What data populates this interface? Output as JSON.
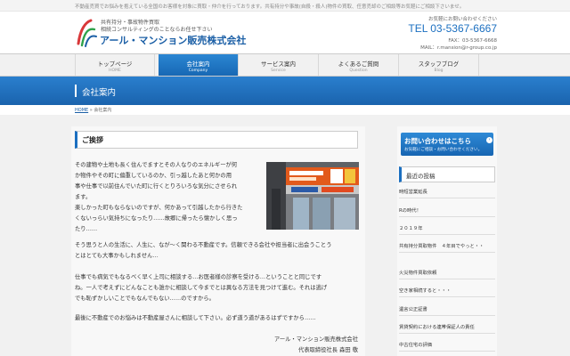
{
  "header": {
    "topbar_text": "不動産売買でお悩みを抱えている全国のお客様を対象に買取・仲介を行っております。共有持分や事故(自殺・殺人)物件の買取、任意売却のご相談等お気軽にご相談下さいませ。",
    "tagline_1": "共有持分・事故物件買取",
    "tagline_2": "相続コンサルティングのことならお任せ下さい",
    "company_name": "アール・マンション販売株式会社",
    "contact_prompt": "お気軽にお問い合わせください",
    "tel": "TEL 03-5367-6667",
    "fax": "FAX：03-5367-6668",
    "mail": "MAIL：r.mansion@r-group.co.jp"
  },
  "nav": [
    {
      "jp": "トップページ",
      "en": "HOME"
    },
    {
      "jp": "会社案内",
      "en": "Company"
    },
    {
      "jp": "サービス案内",
      "en": "Service"
    },
    {
      "jp": "よくあるご質問",
      "en": "Question"
    },
    {
      "jp": "スタッフブログ",
      "en": "Blog"
    }
  ],
  "banner_title": "会社案内",
  "breadcrumb": {
    "home": "HOME",
    "separator": " » ",
    "current": "会社案内"
  },
  "main": {
    "section_title": "ご挨拶",
    "paragraphs": [
      [
        "その建物や土地も長く住んでますとその人なりのエネルギーが何",
        "か物件やその町に偏重しているのか、引っ越したあと何かの用",
        "事や仕事で以前住んでいた町に行くとりろいろな気分にさせられ",
        "ます。"
      ],
      [
        "楽しかった町もならないのですが、何かあって引越したから行きた",
        "くないっらい気持ちになったり……故郷に帰ったら懐かしく思っ",
        "たり……"
      ],
      [
        "そう思うと人の生活に、人生に、なが〜く関わる不動産です。信頼できる会社や担当者に出会うことう",
        "とはとても大事かもしれません…"
      ],
      [
        "仕事でも病気でもなるべく早く上司に相談する…お医者様の診察を受ける…ということと同じです",
        "ね。一人で考えずにどんなことも誰かに相談して今までとは異なる方法を見つけて進む。それは逃げ",
        "でも恥ずかしいことでもなんでもない……のですから。"
      ],
      [
        "最後に不動産でのお悩みは不動産屋さんに相談して下さい。必ず道う道があるはずですから……"
      ]
    ],
    "signature_company": "アール・マンション販売株式会社",
    "signature_rep": "代表取締役社長 森田 敬"
  },
  "sidebar": {
    "contact_button_main": "お問い合わせはこちら",
    "contact_button_sub": "お気軽にご相談・お問い合わせください。",
    "recent_posts_title": "最近の投稿",
    "posts": [
      "時短営業延長",
      "Rの時代！",
      "２０１９年",
      "共有持分買取物件　４年目でやっと・・",
      "火災物件買取依頼",
      "空き家相続すると・・・",
      "遺言公正証書",
      "賃貸契約における連帯保証人の責任",
      "中古住宅の評価"
    ]
  },
  "colors": {
    "brand": "#1b5fa6",
    "accent": "#1b6fc0",
    "logo_red": "#d9383a",
    "logo_green": "#2fa24b"
  }
}
